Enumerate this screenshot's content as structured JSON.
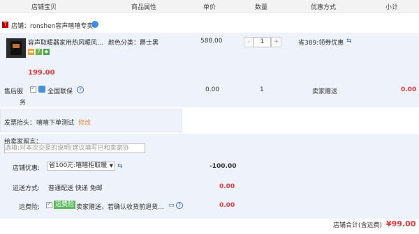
{
  "header": {
    "col_item": "店铺宝贝",
    "col_attr": "商品属性",
    "col_price": "单价",
    "col_qty": "数量",
    "col_discount": "优惠方式",
    "col_subtotal": "小计"
  },
  "store": {
    "label": "店铺：ronshen容声嘻嘻专卖",
    "badge_icon": "tmall-icon"
  },
  "item": {
    "title": "容声取暖器家用热风暖风...",
    "attr": "颜色分类：爵士黑",
    "unit_price": "588.00",
    "qty": "1",
    "qty_minus": "-",
    "qty_plus": "+",
    "discount": "省389:领券优惠",
    "final_price": "199.00",
    "tag_7": "7"
  },
  "service": {
    "label_line1": "售后服",
    "label_line2": "务",
    "option": "全国联保",
    "price": "0.00",
    "qty": "1",
    "ship": "卖家赠送",
    "subtotal": "0.00"
  },
  "invoice": {
    "label": "发票抬头：",
    "value": "嘻嘻下单测试",
    "edit": "修改"
  },
  "message": {
    "label": "给卖家留言：",
    "placeholder": "选填:对本次交易的说明(建议填写已和卖家协"
  },
  "coupon": {
    "label": "店铺优惠:",
    "selected": "省100元:嘻嘻柜取暖",
    "amount": "-100.00"
  },
  "shipping": {
    "label": "运送方式:",
    "value": "普通配送 快递 免邮",
    "amount": "0.00"
  },
  "insurance": {
    "label": "运费险:",
    "chip": "运费险",
    "desc": "卖家赠送，若确认收货前退货...",
    "amount": "0.00"
  },
  "total": {
    "label": "店铺合计(含运费)",
    "amount": "¥99.00"
  },
  "colors": {
    "accent_red": "#e4393c",
    "link_blue": "#3a6fb5",
    "panel_blue": "#eef3fb",
    "chip_green": "#5cb85c"
  }
}
